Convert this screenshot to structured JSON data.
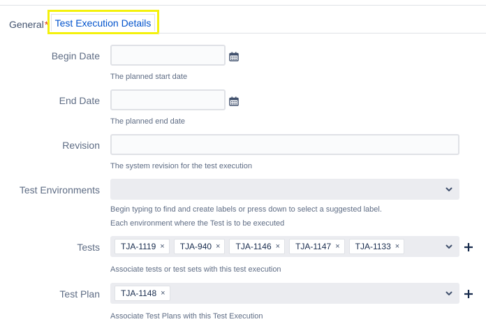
{
  "tabs": {
    "general": "General",
    "required_mark": "*",
    "details": "Test Execution Details"
  },
  "form": {
    "begin_date": {
      "label": "Begin Date",
      "value": "",
      "help": "The planned start date"
    },
    "end_date": {
      "label": "End Date",
      "value": "",
      "help": "The planned end date"
    },
    "revision": {
      "label": "Revision",
      "value": "",
      "help": "The system revision for the test execution"
    },
    "environments": {
      "label": "Test Environments",
      "help_line1": "Begin typing to find and create labels or press down to select a suggested label.",
      "help_line2": "Each environment where the Test is to be executed"
    },
    "tests": {
      "label": "Tests",
      "items": [
        "TJA-1119",
        "TJA-940",
        "TJA-1146",
        "TJA-1147",
        "TJA-1133"
      ],
      "help": "Associate tests or test sets with this test execution"
    },
    "test_plan": {
      "label": "Test Plan",
      "items": [
        "TJA-1148"
      ],
      "help": "Associate Test Plans with this Test Execution"
    }
  },
  "icons": {
    "calendar": "calendar-icon",
    "chevron": "chevron-down-icon",
    "plus": "plus-icon",
    "remove": "×"
  },
  "colors": {
    "highlight": "#f4f10c",
    "active_tab_text": "#0052cc",
    "required": "#de350b",
    "select_bg": "#ebecf0"
  }
}
